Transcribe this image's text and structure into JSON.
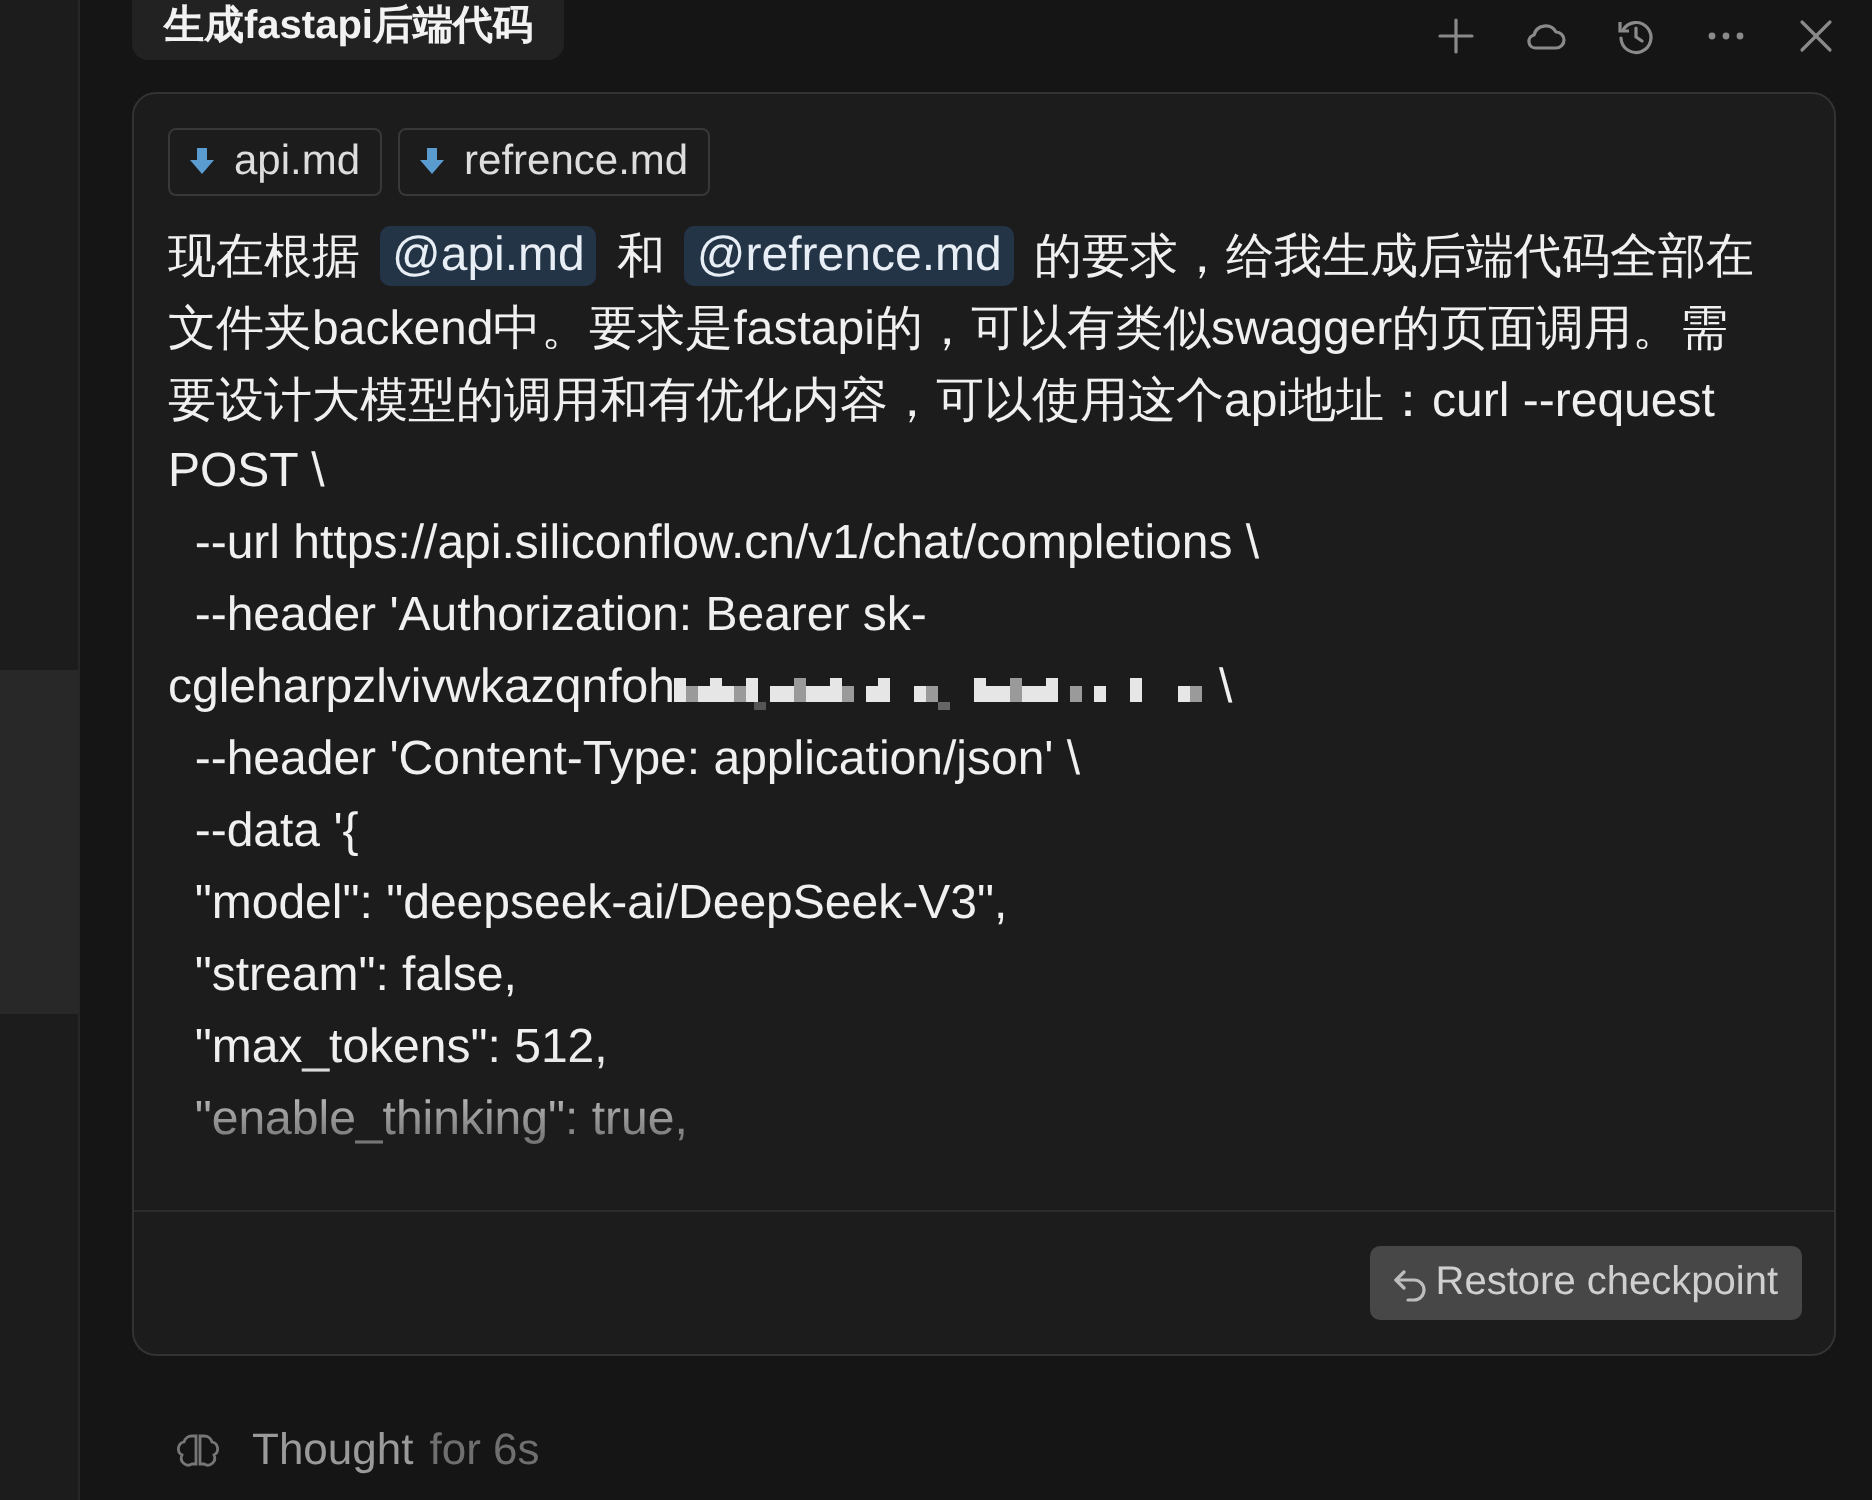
{
  "sidebar": {
    "items": [
      {
        "selected": true
      }
    ]
  },
  "header": {
    "title": "生成fastapi后端代码",
    "actions": [
      {
        "kind": "plus"
      },
      {
        "kind": "cloud"
      },
      {
        "kind": "history"
      },
      {
        "kind": "more"
      },
      {
        "kind": "close"
      }
    ]
  },
  "message": {
    "attachments": [
      "api.md",
      "refrence.md"
    ],
    "lines": [
      [
        {
          "kind": "text",
          "text": "现在根据"
        },
        {
          "kind": "mention",
          "text": "@api.md"
        },
        {
          "kind": "text",
          "text": "和"
        },
        {
          "kind": "mention",
          "text": "@refrence.md"
        },
        {
          "kind": "text",
          "text": "的要求，给我生成后端代码全部在"
        }
      ],
      [
        {
          "kind": "text",
          "text": "文件夹backend中。要求是fastapi的，可以有类似swagger的页面调用。需"
        }
      ],
      [
        {
          "kind": "text",
          "text": "要设计大模型的调用和有优化内容，可以使用这个api地址：curl --request"
        }
      ],
      [
        {
          "kind": "text",
          "text": "POST \\"
        }
      ],
      [
        {
          "kind": "text",
          "text": "  --url https://api.siliconflow.cn/v1/chat/completions \\"
        }
      ],
      [
        {
          "kind": "text",
          "text": "  --header 'Authorization: Bearer sk-"
        }
      ],
      [
        {
          "kind": "text",
          "text": "cgleharpzlvivwkazqnfoh"
        },
        {
          "kind": "redacted"
        },
        {
          "kind": "text",
          "text": "\\"
        }
      ],
      [
        {
          "kind": "text",
          "text": "  --header 'Content-Type: application/json' \\"
        }
      ],
      [
        {
          "kind": "text",
          "text": "  --data '{"
        }
      ],
      [
        {
          "kind": "text",
          "text": "  \"model\": \"deepseek-ai/DeepSeek-V3\","
        }
      ],
      [
        {
          "kind": "text",
          "text": "  \"stream\": false,"
        }
      ],
      [
        {
          "kind": "text",
          "text": "  \"max_tokens\": 512,"
        }
      ],
      [
        {
          "kind": "text",
          "text": "  \"enable_thinking\": true,"
        }
      ]
    ],
    "restore_button": "Restore checkpoint"
  },
  "thought": {
    "label": "Thought",
    "duration": "for 6s"
  }
}
